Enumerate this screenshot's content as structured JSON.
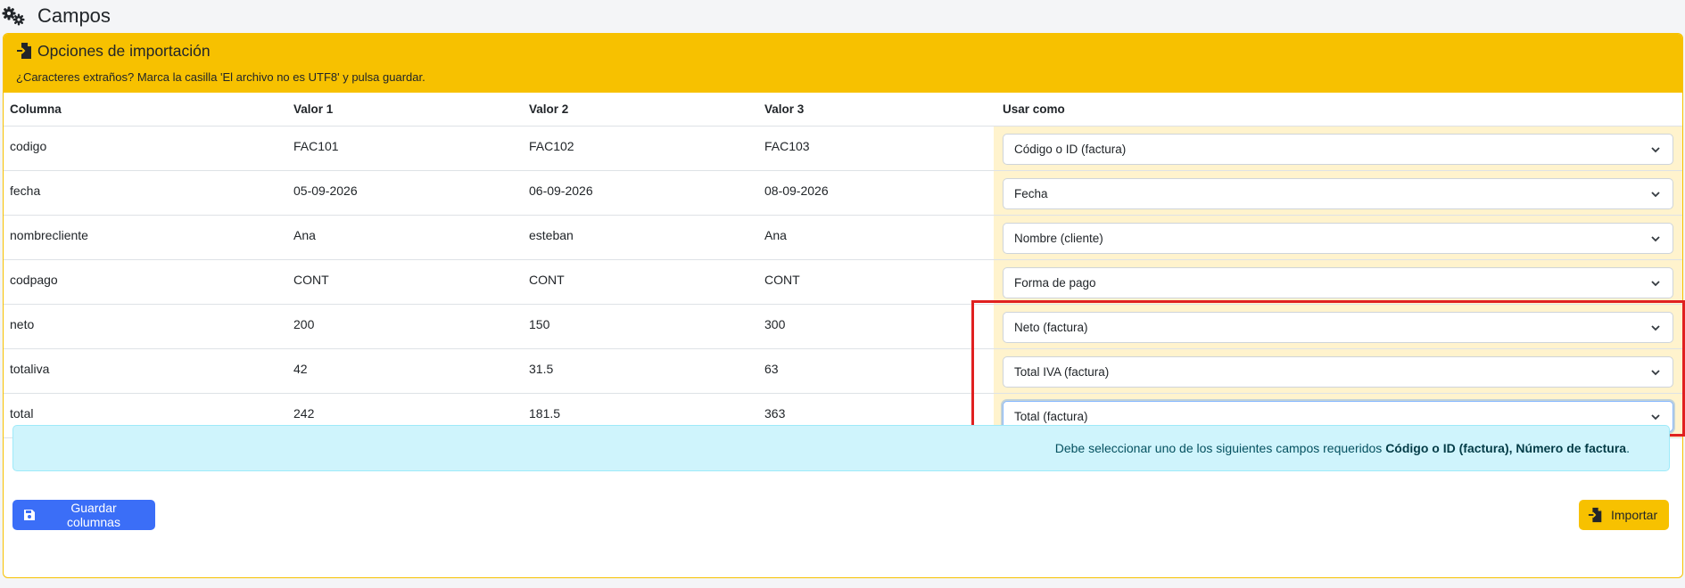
{
  "page": {
    "title": "Campos",
    "icon": "gears-icon"
  },
  "card": {
    "title": "Opciones de importación",
    "title_icon": "file-import-icon",
    "hint": "¿Caracteres extraños? Marca la casilla 'El archivo no es UTF8' y pulsa guardar."
  },
  "table": {
    "headers": [
      "Columna",
      "Valor 1",
      "Valor 2",
      "Valor 3",
      "Usar como"
    ],
    "rows": [
      {
        "column": "codigo",
        "v1": "FAC101",
        "v2": "FAC102",
        "v3": "FAC103",
        "use_as": "Código o ID (factura)"
      },
      {
        "column": "fecha",
        "v1": "05-09-2026",
        "v2": "06-09-2026",
        "v3": "08-09-2026",
        "use_as": "Fecha"
      },
      {
        "column": "nombrecliente",
        "v1": "Ana",
        "v2": "esteban",
        "v3": "Ana",
        "use_as": "Nombre (cliente)"
      },
      {
        "column": "codpago",
        "v1": "CONT",
        "v2": "CONT",
        "v3": "CONT",
        "use_as": "Forma de pago"
      },
      {
        "column": "neto",
        "v1": "200",
        "v2": "150",
        "v3": "300",
        "use_as": "Neto (factura)"
      },
      {
        "column": "totaliva",
        "v1": "42",
        "v2": "31.5",
        "v3": "63",
        "use_as": "Total IVA (factura)"
      },
      {
        "column": "total",
        "v1": "242",
        "v2": "181.5",
        "v3": "363",
        "use_as": "Total (factura)"
      }
    ]
  },
  "alert": {
    "text": "Debe seleccionar uno de los siguientes campos requeridos",
    "required_fields": "Código o ID (factura), Número de factura",
    "end": "."
  },
  "buttons": {
    "save_label": "Guardar columnas",
    "save_icon": "floppy-disk-icon",
    "import_label": "Importar",
    "import_icon": "file-import-icon"
  },
  "colors": {
    "warning": "#f7c100",
    "primary": "#3b6ef7",
    "info_bg": "#cff4fc",
    "highlight": "#e02020"
  }
}
